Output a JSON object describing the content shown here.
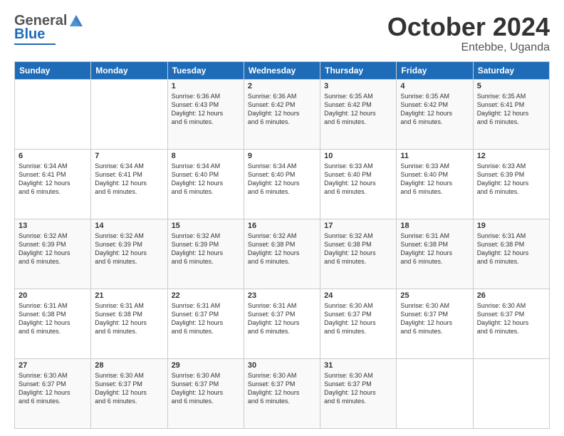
{
  "header": {
    "logo": {
      "line1": "General",
      "line2": "Blue"
    },
    "title": "October 2024",
    "location": "Entebbe, Uganda"
  },
  "weekdays": [
    "Sunday",
    "Monday",
    "Tuesday",
    "Wednesday",
    "Thursday",
    "Friday",
    "Saturday"
  ],
  "weeks": [
    [
      {
        "day": "",
        "info": ""
      },
      {
        "day": "",
        "info": ""
      },
      {
        "day": "1",
        "info": "Sunrise: 6:36 AM\nSunset: 6:43 PM\nDaylight: 12 hours\nand 6 minutes."
      },
      {
        "day": "2",
        "info": "Sunrise: 6:36 AM\nSunset: 6:42 PM\nDaylight: 12 hours\nand 6 minutes."
      },
      {
        "day": "3",
        "info": "Sunrise: 6:35 AM\nSunset: 6:42 PM\nDaylight: 12 hours\nand 6 minutes."
      },
      {
        "day": "4",
        "info": "Sunrise: 6:35 AM\nSunset: 6:42 PM\nDaylight: 12 hours\nand 6 minutes."
      },
      {
        "day": "5",
        "info": "Sunrise: 6:35 AM\nSunset: 6:41 PM\nDaylight: 12 hours\nand 6 minutes."
      }
    ],
    [
      {
        "day": "6",
        "info": "Sunrise: 6:34 AM\nSunset: 6:41 PM\nDaylight: 12 hours\nand 6 minutes."
      },
      {
        "day": "7",
        "info": "Sunrise: 6:34 AM\nSunset: 6:41 PM\nDaylight: 12 hours\nand 6 minutes."
      },
      {
        "day": "8",
        "info": "Sunrise: 6:34 AM\nSunset: 6:40 PM\nDaylight: 12 hours\nand 6 minutes."
      },
      {
        "day": "9",
        "info": "Sunrise: 6:34 AM\nSunset: 6:40 PM\nDaylight: 12 hours\nand 6 minutes."
      },
      {
        "day": "10",
        "info": "Sunrise: 6:33 AM\nSunset: 6:40 PM\nDaylight: 12 hours\nand 6 minutes."
      },
      {
        "day": "11",
        "info": "Sunrise: 6:33 AM\nSunset: 6:40 PM\nDaylight: 12 hours\nand 6 minutes."
      },
      {
        "day": "12",
        "info": "Sunrise: 6:33 AM\nSunset: 6:39 PM\nDaylight: 12 hours\nand 6 minutes."
      }
    ],
    [
      {
        "day": "13",
        "info": "Sunrise: 6:32 AM\nSunset: 6:39 PM\nDaylight: 12 hours\nand 6 minutes."
      },
      {
        "day": "14",
        "info": "Sunrise: 6:32 AM\nSunset: 6:39 PM\nDaylight: 12 hours\nand 6 minutes."
      },
      {
        "day": "15",
        "info": "Sunrise: 6:32 AM\nSunset: 6:39 PM\nDaylight: 12 hours\nand 6 minutes."
      },
      {
        "day": "16",
        "info": "Sunrise: 6:32 AM\nSunset: 6:38 PM\nDaylight: 12 hours\nand 6 minutes."
      },
      {
        "day": "17",
        "info": "Sunrise: 6:32 AM\nSunset: 6:38 PM\nDaylight: 12 hours\nand 6 minutes."
      },
      {
        "day": "18",
        "info": "Sunrise: 6:31 AM\nSunset: 6:38 PM\nDaylight: 12 hours\nand 6 minutes."
      },
      {
        "day": "19",
        "info": "Sunrise: 6:31 AM\nSunset: 6:38 PM\nDaylight: 12 hours\nand 6 minutes."
      }
    ],
    [
      {
        "day": "20",
        "info": "Sunrise: 6:31 AM\nSunset: 6:38 PM\nDaylight: 12 hours\nand 6 minutes."
      },
      {
        "day": "21",
        "info": "Sunrise: 6:31 AM\nSunset: 6:38 PM\nDaylight: 12 hours\nand 6 minutes."
      },
      {
        "day": "22",
        "info": "Sunrise: 6:31 AM\nSunset: 6:37 PM\nDaylight: 12 hours\nand 6 minutes."
      },
      {
        "day": "23",
        "info": "Sunrise: 6:31 AM\nSunset: 6:37 PM\nDaylight: 12 hours\nand 6 minutes."
      },
      {
        "day": "24",
        "info": "Sunrise: 6:30 AM\nSunset: 6:37 PM\nDaylight: 12 hours\nand 6 minutes."
      },
      {
        "day": "25",
        "info": "Sunrise: 6:30 AM\nSunset: 6:37 PM\nDaylight: 12 hours\nand 6 minutes."
      },
      {
        "day": "26",
        "info": "Sunrise: 6:30 AM\nSunset: 6:37 PM\nDaylight: 12 hours\nand 6 minutes."
      }
    ],
    [
      {
        "day": "27",
        "info": "Sunrise: 6:30 AM\nSunset: 6:37 PM\nDaylight: 12 hours\nand 6 minutes."
      },
      {
        "day": "28",
        "info": "Sunrise: 6:30 AM\nSunset: 6:37 PM\nDaylight: 12 hours\nand 6 minutes."
      },
      {
        "day": "29",
        "info": "Sunrise: 6:30 AM\nSunset: 6:37 PM\nDaylight: 12 hours\nand 6 minutes."
      },
      {
        "day": "30",
        "info": "Sunrise: 6:30 AM\nSunset: 6:37 PM\nDaylight: 12 hours\nand 6 minutes."
      },
      {
        "day": "31",
        "info": "Sunrise: 6:30 AM\nSunset: 6:37 PM\nDaylight: 12 hours\nand 6 minutes."
      },
      {
        "day": "",
        "info": ""
      },
      {
        "day": "",
        "info": ""
      }
    ]
  ]
}
